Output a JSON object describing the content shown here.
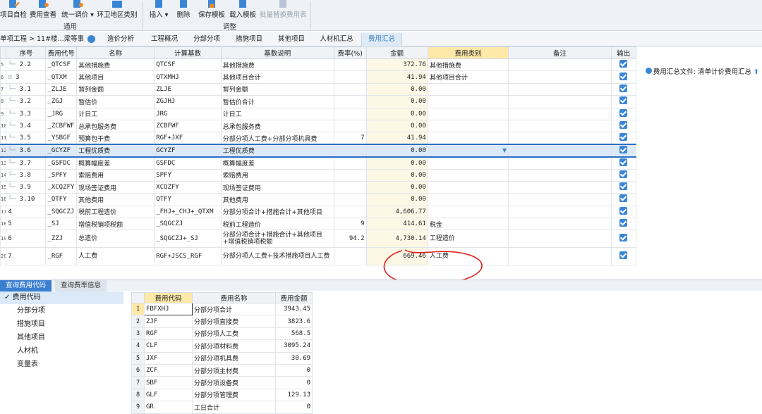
{
  "ribbon": {
    "buttons": [
      {
        "label": "项目自检",
        "icon": "check-project-icon"
      },
      {
        "label": "费用查看",
        "icon": "view-cost-icon"
      },
      {
        "label": "统一调价 ▾",
        "icon": "adjust-price-icon"
      },
      {
        "label": "环卫地区类别",
        "icon": "region-class-icon"
      },
      {
        "label": "插入 ▾",
        "icon": "insert-icon"
      },
      {
        "label": "删除",
        "icon": "delete-icon"
      },
      {
        "label": "保存模板",
        "icon": "save-template-icon"
      },
      {
        "label": "载入模板",
        "icon": "load-template-icon"
      },
      {
        "label": "批量替换费用表",
        "icon": "batch-replace-icon"
      }
    ],
    "group_general": "通用",
    "group_adjust": "调整"
  },
  "breadcrumb": "单项工程 > 11#楼...梁等事宜",
  "tabs": [
    "造价分析",
    "工程概况",
    "分部分项",
    "措施项目",
    "其他项目",
    "人材机汇总",
    "费用汇总"
  ],
  "summary_file": "费用汇总文件: 清单计价费用汇总",
  "table": {
    "headers": [
      "序号",
      "费用代号",
      "名称",
      "计算基数",
      "基数说明",
      "费率(%)",
      "金额",
      "费用类别",
      "备注",
      "输出"
    ],
    "rows": [
      {
        "num": "2.2",
        "code": "_QTCSF",
        "name": "其他措施费",
        "base": "QTCSF",
        "desc": "其他措施费",
        "rate": "",
        "amount": "372.76",
        "cat": "其他措施费"
      },
      {
        "num": "3",
        "code": "_QTXM",
        "name": "其他项目",
        "base": "QTXMHJ",
        "desc": "其他项目合计",
        "rate": "",
        "amount": "41.94",
        "cat": "其他项目合计"
      },
      {
        "num": "3.1",
        "code": "_ZLJE",
        "name": "暂列金额",
        "base": "ZLJE",
        "desc": "暂列金额",
        "rate": "",
        "amount": "0.00",
        "cat": ""
      },
      {
        "num": "3.2",
        "code": "_ZGJ",
        "name": "暂估价",
        "base": "ZGJHJ",
        "desc": "暂估价合计",
        "rate": "",
        "amount": "0.00",
        "cat": ""
      },
      {
        "num": "3.3",
        "code": "_JRG",
        "name": "计日工",
        "base": "JRG",
        "desc": "计日工",
        "rate": "",
        "amount": "0.00",
        "cat": ""
      },
      {
        "num": "3.4",
        "code": "_ZCBFWF",
        "name": "总承包服务费",
        "base": "ZCBFWF",
        "desc": "总承包服务费",
        "rate": "",
        "amount": "0.00",
        "cat": ""
      },
      {
        "num": "3.5",
        "code": "_YSBGF",
        "name": "预算包干费",
        "base": "RGF+JXF",
        "desc": "分部分项人工费+分部分项机具费",
        "rate": "7",
        "amount": "41.94",
        "cat": ""
      },
      {
        "num": "3.6",
        "code": "_GCYZF",
        "name": "工程优质费",
        "base": "GCYZF",
        "desc": "工程优质费",
        "rate": "",
        "amount": "0.00",
        "cat": ""
      },
      {
        "num": "3.7",
        "code": "_GSFDC",
        "name": "概算幅度差",
        "base": "GSFDC",
        "desc": "概算幅度差",
        "rate": "",
        "amount": "0.00",
        "cat": ""
      },
      {
        "num": "3.8",
        "code": "_SPFY",
        "name": "索赔费用",
        "base": "SPFY",
        "desc": "索赔费用",
        "rate": "",
        "amount": "0.00",
        "cat": ""
      },
      {
        "num": "3.9",
        "code": "_XCQZFY",
        "name": "现场签证费用",
        "base": "XCQZFY",
        "desc": "现场签证费用",
        "rate": "",
        "amount": "0.00",
        "cat": ""
      },
      {
        "num": "3.10",
        "code": "_QTFY",
        "name": "其他费用",
        "base": "QTFY",
        "desc": "其他费用",
        "rate": "",
        "amount": "0.00",
        "cat": ""
      },
      {
        "num": "4",
        "code": "_SQGCZJ",
        "name": "税前工程造价",
        "base": "_FHJ+_CHJ+_QTXM",
        "desc": "分部分项合计+措施合计+其他项目",
        "rate": "",
        "amount": "4,606.77",
        "cat": ""
      },
      {
        "num": "5",
        "code": "_SJ",
        "name": "增值税销项税额",
        "base": "_SQGCZJ",
        "desc": "税前工程造价",
        "rate": "9",
        "amount": "414.61",
        "cat": "税金"
      },
      {
        "num": "6",
        "code": "_ZZJ",
        "name": "总造价",
        "base": "_SQGCZJ+_SJ",
        "desc": "分部分项合计+措施合计+其他项目+增值税销项税额",
        "rate": "94.2",
        "amount": "4,730.14",
        "cat": "工程造价"
      },
      {
        "num": "7",
        "code": "_RGF",
        "name": "人工费",
        "base": "RGF+JSCS_RGF",
        "desc": "分部分项人工费+技术措施项目人工费",
        "rate": "",
        "amount": "669.46",
        "cat": "人工费"
      }
    ],
    "row_ids": [
      "5",
      "6",
      "7",
      "8",
      "9",
      "10",
      "11",
      "12",
      "13",
      "14",
      "15",
      "16",
      "17",
      "18",
      "19",
      "20"
    ]
  },
  "bottom_tabs": [
    "查询费用代码",
    "查询费率信息"
  ],
  "side_tree": {
    "root": "费用代码",
    "items": [
      "分部分项",
      "措施项目",
      "其他项目",
      "人材机",
      "变量表"
    ]
  },
  "sub_table": {
    "headers": [
      "费用代码",
      "费用名称",
      "费用金额"
    ],
    "rows": [
      {
        "idx": "1",
        "code": "FBFXHJ",
        "name": "分部分项合计",
        "amount": "3943.45"
      },
      {
        "idx": "2",
        "code": "ZJF",
        "name": "分部分项直接费",
        "amount": "3823.6"
      },
      {
        "idx": "3",
        "code": "RGF",
        "name": "分部分项人工费",
        "amount": "568.5"
      },
      {
        "idx": "4",
        "code": "CLF",
        "name": "分部分项材料费",
        "amount": "3095.24"
      },
      {
        "idx": "5",
        "code": "JXF",
        "name": "分部分项机具费",
        "amount": "30.69"
      },
      {
        "idx": "6",
        "code": "ZCF",
        "name": "分部分项主材费",
        "amount": "0"
      },
      {
        "idx": "7",
        "code": "SBF",
        "name": "分部分项设备费",
        "amount": "0"
      },
      {
        "idx": "8",
        "code": "GLF",
        "name": "分部分项管理费",
        "amount": "129.13"
      },
      {
        "idx": "9",
        "code": "GR",
        "name": "工日合计",
        "amount": "0"
      }
    ]
  },
  "colors": {
    "accent": "#3b82c4",
    "annotation": "#e02020",
    "amount_bg": "#fdf8e6"
  }
}
